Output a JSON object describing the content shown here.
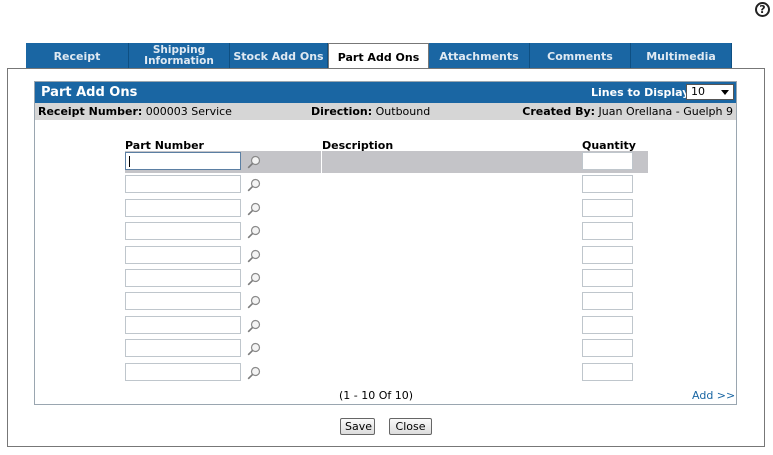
{
  "help_label": "?",
  "tabs": [
    {
      "label": "Receipt"
    },
    {
      "label": "Shipping"
    },
    {
      "label": "Stock Add Ons"
    },
    {
      "label": "Part Add Ons"
    },
    {
      "label": "Attachments"
    },
    {
      "label": "Comments"
    },
    {
      "label": "Multimedia"
    }
  ],
  "shipping_tab": {
    "line1": "Shipping",
    "line2": "Information"
  },
  "panel": {
    "title": "Part Add Ons",
    "lines_label": "Lines to Display:",
    "lines_value": "10"
  },
  "info": {
    "receipt_label": "Receipt Number:",
    "receipt_value": " 000003  Service",
    "direction_label": "Direction:",
    "direction_value": " Outbound",
    "created_label": "Created By:",
    "created_value": " Juan Orellana -  Guelph 9"
  },
  "columns": {
    "part_number": "Part Number",
    "description": "Description",
    "quantity": "Quantity"
  },
  "row_count": 10,
  "pager": "(1  -  10  Of  10)",
  "add_link": "Add >>",
  "buttons": {
    "save": "Save",
    "close": "Close"
  },
  "colors": {
    "accent": "#1a66a3",
    "header_bar": "#d6d6d6",
    "highlight_row": "#c4c4c8"
  }
}
